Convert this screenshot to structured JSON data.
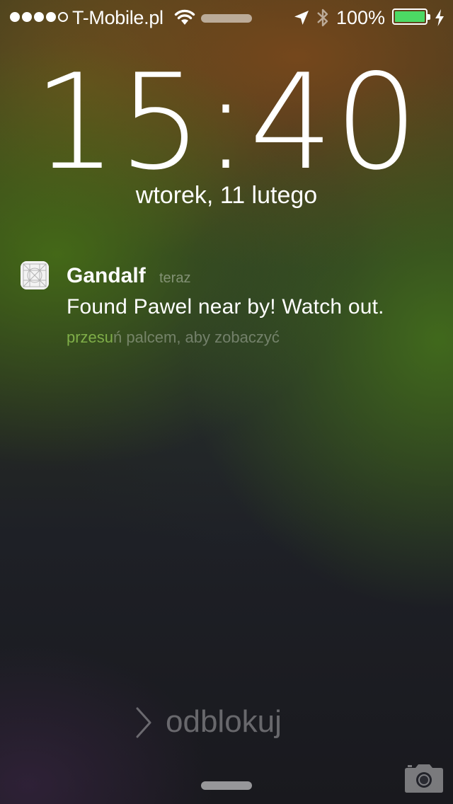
{
  "status_bar": {
    "signal_bars_total": 5,
    "signal_bars_filled": 4,
    "carrier": "T-Mobile.pl",
    "wifi_icon": "wifi-icon",
    "location_icon": "location-arrow-icon",
    "bluetooth_icon": "bluetooth-icon",
    "battery_percent": "100%",
    "battery_level": 1.0,
    "battery_color": "#4cd964",
    "charging_icon": "bolt-icon"
  },
  "lock_screen": {
    "time": "15:40",
    "date": "wtorek, 11 lutego"
  },
  "notification": {
    "app_icon": "app-grid-icon",
    "app_name": "Gandalf",
    "time": "teraz",
    "message": "Found Pawel near by! Watch out.",
    "hint_highlight": "przesu",
    "hint_rest": "ń palcem, aby zobaczyć"
  },
  "unlock": {
    "label": "odblokuj",
    "chevron_icon": "chevron-right-icon"
  },
  "bottom": {
    "camera_icon": "camera-icon"
  }
}
